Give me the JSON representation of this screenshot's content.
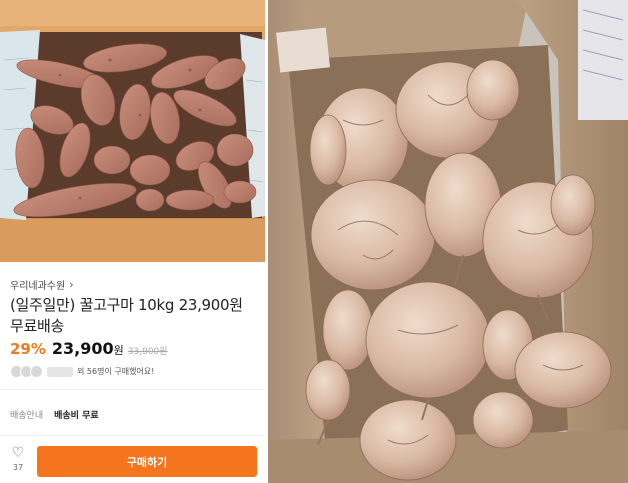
{
  "product": {
    "store_name": "우리네과수원",
    "store_chevron": "›",
    "title": "(일주일만) 꿀고구마 10kg 23,900원 무료배송",
    "discount": "29%",
    "price": "23,900",
    "price_unit": "원",
    "original_price": "33,900원",
    "buyers_text": "외 56명이 구매했어요!",
    "shipping_label": "배송안내",
    "shipping_value": "배송비 무료",
    "like_count": "37",
    "buy_label": "구매하기"
  },
  "icons": {
    "store_arrow": "chevron-right-icon",
    "like": "heart-outline-icon"
  },
  "colors": {
    "accent": "#f4751e",
    "discount": "#f07a1e"
  }
}
